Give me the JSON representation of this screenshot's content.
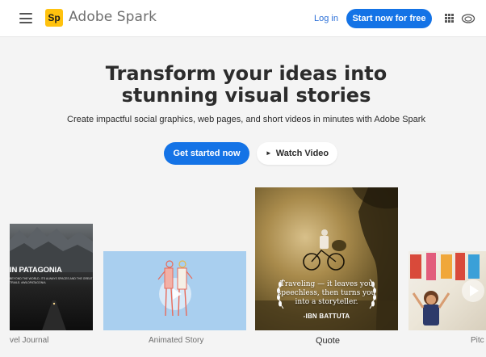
{
  "header": {
    "logo_text": "Sp",
    "brand": "Adobe Spark",
    "login": "Log in",
    "start_button": "Start now for free",
    "icons": [
      "hamburger-menu-icon",
      "app-grid-icon",
      "creative-cloud-icon"
    ]
  },
  "hero": {
    "headline": "Transform your ideas into stunning visual stories",
    "subhead": "Create impactful social graphics, web pages, and short videos in minutes with Adobe Spark",
    "cta": "Get started now",
    "watch": "Watch Video"
  },
  "cards": [
    {
      "label": "vel Journal",
      "title": "IN PATAGONIA",
      "subtitle": "BEYOND THE WORLD, ITS ALWAYS SPACES AND THE GREAT TRAILS. #WILDPATAGONIA"
    },
    {
      "label": "Animated Story"
    },
    {
      "label": "Quote",
      "quote": "Traveling — it leaves you speechless, then turns you into a storyteller.",
      "author": "-IBN BATTUTA"
    },
    {
      "label": "Pitc"
    }
  ],
  "colors": {
    "accent": "#1473e6",
    "logo": "#ffc20e",
    "background": "#f4f4f4"
  }
}
